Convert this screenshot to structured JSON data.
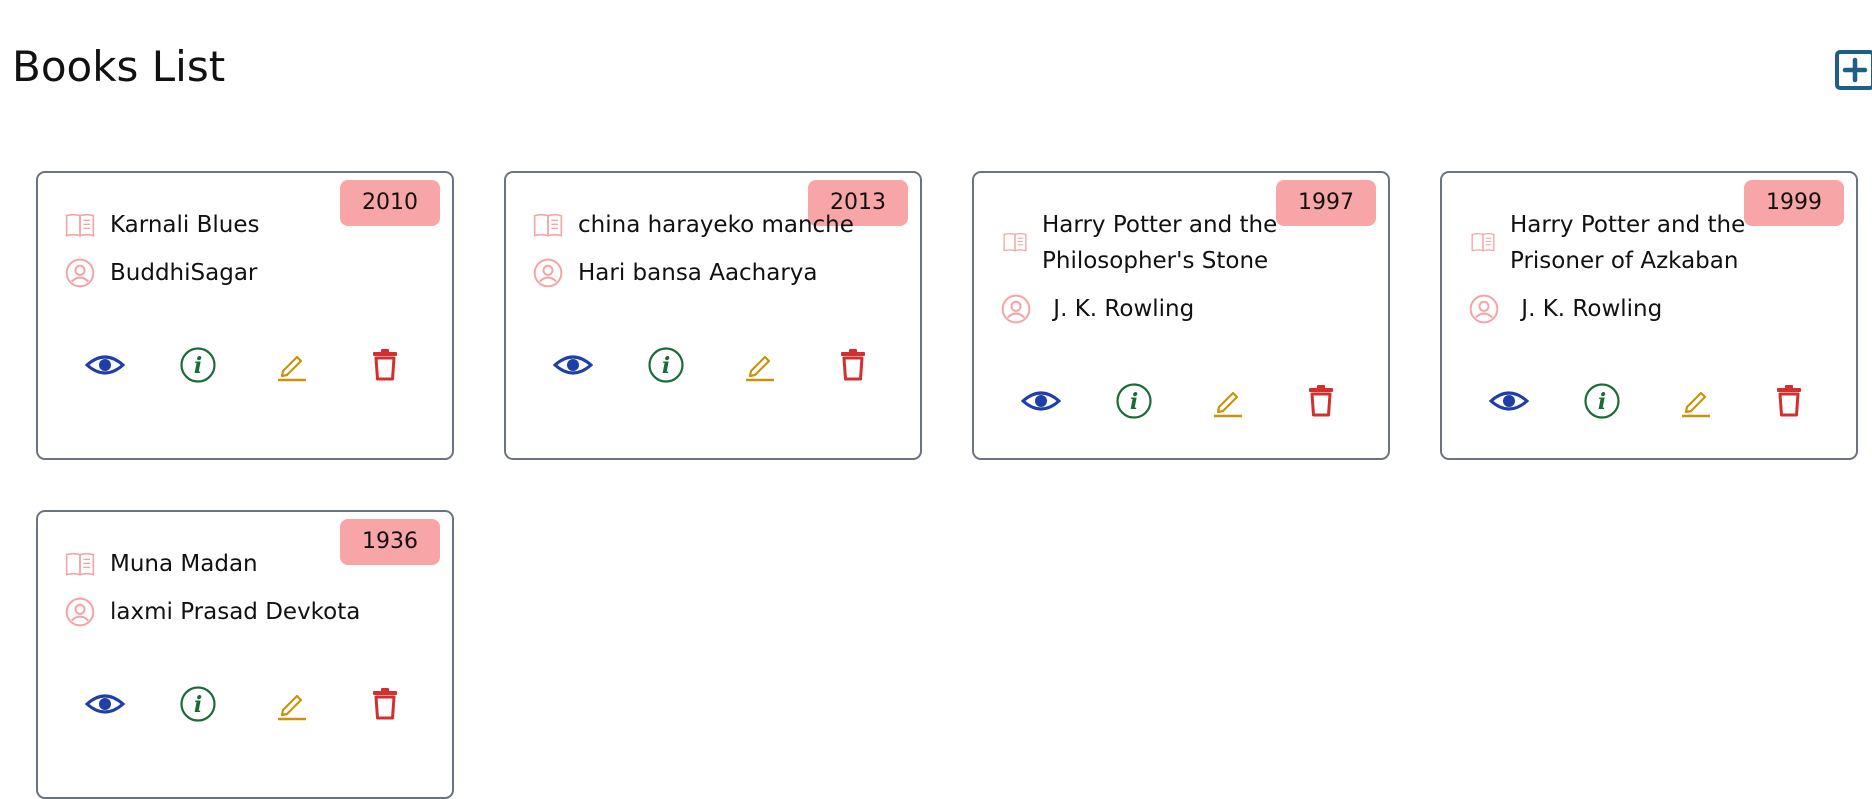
{
  "header": {
    "title": "Books List",
    "add_icon": "plus-square-icon"
  },
  "colors": {
    "badge": "#f8a5a8",
    "view": "#1e3fa8",
    "info": "#1b6b3a",
    "edit": "#c9930e",
    "delete": "#d32f2f",
    "meta_icon": "#f4a4a7",
    "card_border": "#6b7280",
    "add_button": "#1f5f87"
  },
  "books": [
    {
      "title": "Karnali Blues",
      "author": "BuddhiSagar",
      "year": "2010"
    },
    {
      "title": "china harayeko manche",
      "author": "Hari bansa Aacharya",
      "year": "2013"
    },
    {
      "title": "Harry Potter and the Philosopher's Stone",
      "author": " J. K. Rowling",
      "year": "1997"
    },
    {
      "title": "Harry Potter and the Prisoner of Azkaban",
      "author": " J. K. Rowling",
      "year": "1999"
    },
    {
      "title": "Muna Madan",
      "author": "laxmi Prasad Devkota",
      "year": "1936"
    }
  ],
  "card_icons": {
    "title": "open-book-icon",
    "author": "user-circle-icon",
    "actions": [
      "eye-icon",
      "info-circle-icon",
      "pencil-icon",
      "trash-icon"
    ]
  }
}
